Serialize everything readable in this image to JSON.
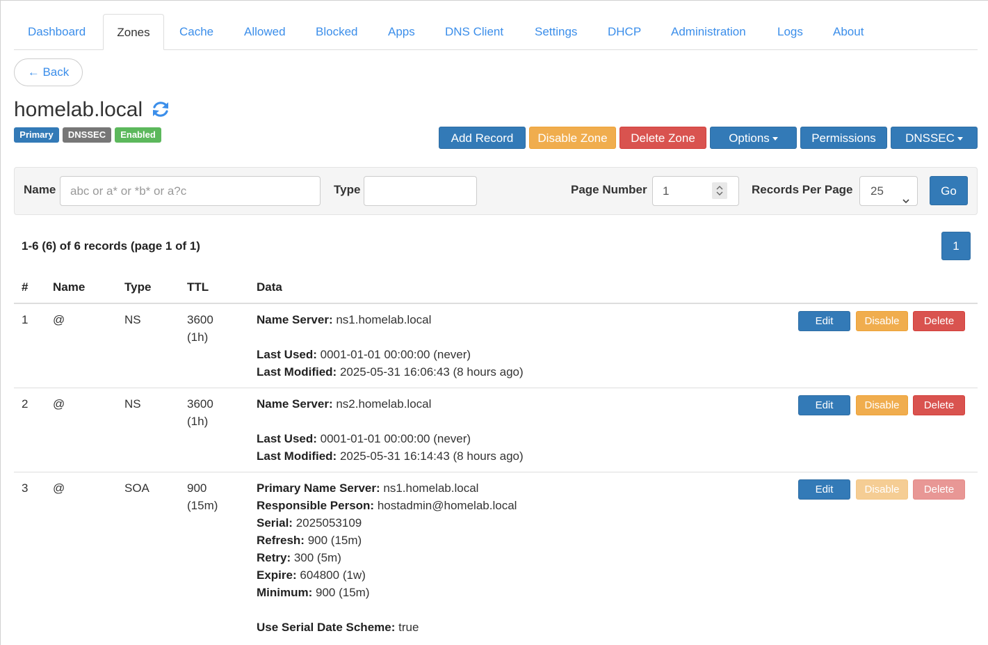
{
  "tabs": [
    "Dashboard",
    "Zones",
    "Cache",
    "Allowed",
    "Blocked",
    "Apps",
    "DNS Client",
    "Settings",
    "DHCP",
    "Administration",
    "Logs",
    "About"
  ],
  "back_label": "← Back",
  "zone": {
    "name": "homelab.local",
    "badges": [
      "Primary",
      "DNSSEC",
      "Enabled"
    ],
    "badge_colors": {
      "Primary": "#337ab7",
      "DNSSEC": "#777777",
      "Enabled": "#5cb85c"
    }
  },
  "actions": {
    "add_record": "Add Record",
    "disable_zone": "Disable Zone",
    "delete_zone": "Delete Zone",
    "options": "Options",
    "permissions": "Permissions",
    "dnssec": "DNSSEC"
  },
  "filter": {
    "name_label": "Name",
    "name_placeholder": "abc or a* or *b* or a?c",
    "type_label": "Type",
    "type_value": "",
    "page_number_label": "Page Number",
    "page_number_value": "1",
    "records_per_page_label": "Records Per Page",
    "records_per_page_value": "25",
    "go_label": "Go"
  },
  "summary": "1-6 (6) of 6 records (page 1 of 1)",
  "pagination": {
    "current": "1"
  },
  "table": {
    "headers": [
      "#",
      "Name",
      "Type",
      "TTL",
      "Data"
    ],
    "row_actions": {
      "edit": "Edit",
      "disable": "Disable",
      "delete": "Delete"
    },
    "rows": [
      {
        "num": "1",
        "name": "@",
        "type": "NS",
        "ttl": "3600",
        "ttl_human": "(1h)",
        "data": [
          {
            "label": "Name Server:",
            "value": " ns1.homelab.local"
          },
          {
            "label": "Last Used:",
            "value": " 0001-01-01 00:00:00 (never)"
          },
          {
            "label": "Last Modified:",
            "value": " 2025-05-31 16:06:43 (8 hours ago)"
          }
        ]
      },
      {
        "num": "2",
        "name": "@",
        "type": "NS",
        "ttl": "3600",
        "ttl_human": "(1h)",
        "data": [
          {
            "label": "Name Server:",
            "value": " ns2.homelab.local"
          },
          {
            "label": "Last Used:",
            "value": " 0001-01-01 00:00:00 (never)"
          },
          {
            "label": "Last Modified:",
            "value": " 2025-05-31 16:14:43 (8 hours ago)"
          }
        ]
      },
      {
        "num": "3",
        "name": "@",
        "type": "SOA",
        "ttl": "900",
        "ttl_human": "(15m)",
        "data": [
          {
            "label": "Primary Name Server:",
            "value": " ns1.homelab.local"
          },
          {
            "label": "Responsible Person:",
            "value": " hostadmin@homelab.local"
          },
          {
            "label": "Serial:",
            "value": " 2025053109"
          },
          {
            "label": "Refresh:",
            "value": " 900 (15m)"
          },
          {
            "label": "Retry:",
            "value": " 300 (5m)"
          },
          {
            "label": "Expire:",
            "value": " 604800 (1w)"
          },
          {
            "label": "Minimum:",
            "value": " 900 (15m)"
          },
          {
            "label": "Use Serial Date Scheme:",
            "value": " true"
          }
        ]
      }
    ]
  },
  "colors": {
    "link": "#3b8eea",
    "primary": "#337ab7",
    "warning": "#f0ad4e",
    "danger": "#d9534f",
    "success": "#5cb85c"
  }
}
